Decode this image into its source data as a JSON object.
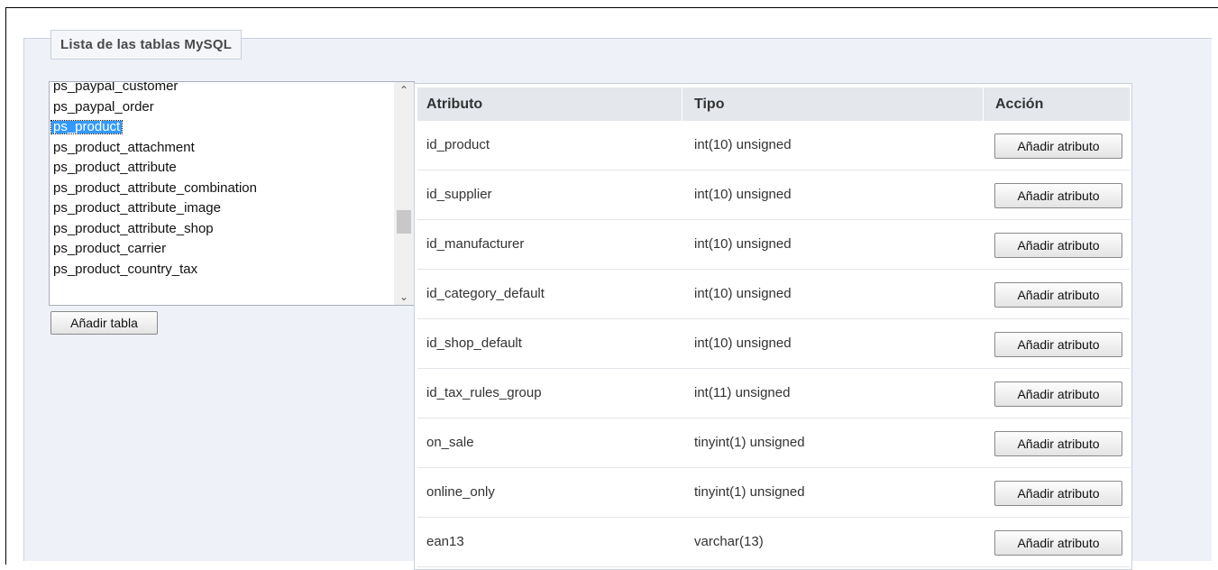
{
  "legend": "Lista de las tablas MySQL",
  "tables": {
    "items": [
      "ps_paypal_customer",
      "ps_paypal_order",
      "ps_product",
      "ps_product_attachment",
      "ps_product_attribute",
      "ps_product_attribute_combination",
      "ps_product_attribute_image",
      "ps_product_attribute_shop",
      "ps_product_carrier",
      "ps_product_country_tax"
    ],
    "selected": "ps_product",
    "scroll_up_icon": "chevron-up-icon",
    "scroll_down_icon": "chevron-down-icon"
  },
  "add_table_label": "Añadir tabla",
  "columns": {
    "attr": "Atributo",
    "tipo": "Tipo",
    "accion": "Acción"
  },
  "rows": [
    {
      "attr": "id_product",
      "tipo": "int(10) unsigned",
      "action": "Añadir atributo"
    },
    {
      "attr": "id_supplier",
      "tipo": "int(10) unsigned",
      "action": "Añadir atributo"
    },
    {
      "attr": "id_manufacturer",
      "tipo": "int(10) unsigned",
      "action": "Añadir atributo"
    },
    {
      "attr": "id_category_default",
      "tipo": "int(10) unsigned",
      "action": "Añadir atributo"
    },
    {
      "attr": "id_shop_default",
      "tipo": "int(10) unsigned",
      "action": "Añadir atributo"
    },
    {
      "attr": "id_tax_rules_group",
      "tipo": "int(11) unsigned",
      "action": "Añadir atributo"
    },
    {
      "attr": "on_sale",
      "tipo": "tinyint(1) unsigned",
      "action": "Añadir atributo"
    },
    {
      "attr": "online_only",
      "tipo": "tinyint(1) unsigned",
      "action": "Añadir atributo"
    },
    {
      "attr": "ean13",
      "tipo": "varchar(13)",
      "action": "Añadir atributo"
    }
  ],
  "colors": {
    "selection": "#3399ff",
    "panel": "#eef1f7",
    "header": "#e4e7ec"
  }
}
